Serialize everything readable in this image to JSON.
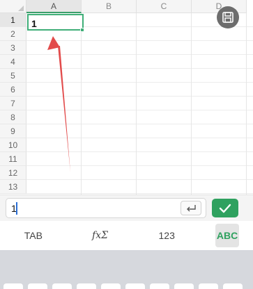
{
  "columns": [
    "A",
    "B",
    "C",
    "D"
  ],
  "rows": [
    "1",
    "2",
    "3",
    "4",
    "5",
    "6",
    "7",
    "8",
    "9",
    "10",
    "11",
    "12",
    "13"
  ],
  "active_cell": {
    "value": "1"
  },
  "formula_bar": {
    "value": "1"
  },
  "keyboard_tabs": {
    "tab": "TAB",
    "fx": "fxΣ",
    "num": "123",
    "abc": "ABC"
  },
  "icons": {
    "save": "floppy-disk-icon",
    "enter": "return-arrow-icon",
    "confirm": "checkmark-icon",
    "corner": "select-all-triangle-icon"
  },
  "colors": {
    "accent_green": "#2fa15f",
    "selection_border": "#3fae78",
    "annotation_arrow": "#e24b4b"
  }
}
